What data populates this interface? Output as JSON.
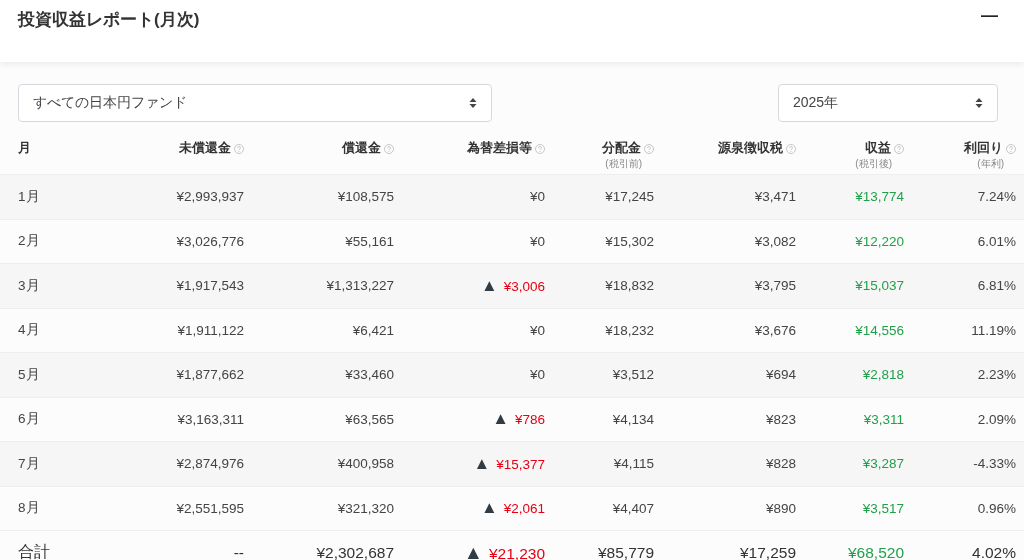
{
  "panel": {
    "title": "投資収益レポート(月次)",
    "collapse_symbol": "—"
  },
  "filters": {
    "fund": {
      "value": "すべての日本円ファンド"
    },
    "year": {
      "value": "2025年"
    }
  },
  "table": {
    "columns": [
      {
        "label": "月"
      },
      {
        "label": "未償還金",
        "help": true
      },
      {
        "label": "償還金",
        "help": true
      },
      {
        "label": "為替差損等",
        "help": true
      },
      {
        "label": "分配金",
        "sub": "(税引前)",
        "help": true
      },
      {
        "label": "源泉徴収税",
        "help": true
      },
      {
        "label": "収益",
        "sub": "(税引後)",
        "help": true
      },
      {
        "label": "利回り",
        "sub": "(年利)",
        "help": true
      }
    ],
    "rows": [
      {
        "month": "1月",
        "outstanding": "¥2,993,937",
        "redemption": "¥108,575",
        "fx": {
          "negative": false,
          "amount": "¥0"
        },
        "distribution": "¥17,245",
        "tax": "¥3,471",
        "profit": "¥13,774",
        "yield": "7.24%"
      },
      {
        "month": "2月",
        "outstanding": "¥3,026,776",
        "redemption": "¥55,161",
        "fx": {
          "negative": false,
          "amount": "¥0"
        },
        "distribution": "¥15,302",
        "tax": "¥3,082",
        "profit": "¥12,220",
        "yield": "6.01%"
      },
      {
        "month": "3月",
        "outstanding": "¥1,917,543",
        "redemption": "¥1,313,227",
        "fx": {
          "negative": true,
          "mark": "▲",
          "amount": "¥3,006"
        },
        "distribution": "¥18,832",
        "tax": "¥3,795",
        "profit": "¥15,037",
        "yield": "6.81%"
      },
      {
        "month": "4月",
        "outstanding": "¥1,911,122",
        "redemption": "¥6,421",
        "fx": {
          "negative": false,
          "amount": "¥0"
        },
        "distribution": "¥18,232",
        "tax": "¥3,676",
        "profit": "¥14,556",
        "yield": "11.19%"
      },
      {
        "month": "5月",
        "outstanding": "¥1,877,662",
        "redemption": "¥33,460",
        "fx": {
          "negative": false,
          "amount": "¥0"
        },
        "distribution": "¥3,512",
        "tax": "¥694",
        "profit": "¥2,818",
        "yield": "2.23%"
      },
      {
        "month": "6月",
        "outstanding": "¥3,163,311",
        "redemption": "¥63,565",
        "fx": {
          "negative": true,
          "mark": "▲",
          "amount": "¥786"
        },
        "distribution": "¥4,134",
        "tax": "¥823",
        "profit": "¥3,311",
        "yield": "2.09%"
      },
      {
        "month": "7月",
        "outstanding": "¥2,874,976",
        "redemption": "¥400,958",
        "fx": {
          "negative": true,
          "mark": "▲",
          "amount": "¥15,377"
        },
        "distribution": "¥4,115",
        "tax": "¥828",
        "profit": "¥3,287",
        "yield": "-4.33%"
      },
      {
        "month": "8月",
        "outstanding": "¥2,551,595",
        "redemption": "¥321,320",
        "fx": {
          "negative": true,
          "mark": "▲",
          "amount": "¥2,061"
        },
        "distribution": "¥4,407",
        "tax": "¥890",
        "profit": "¥3,517",
        "yield": "0.96%"
      }
    ],
    "total": {
      "month": "合計",
      "outstanding": "--",
      "redemption": "¥2,302,687",
      "fx": {
        "negative": true,
        "mark": "▲",
        "amount": "¥21,230"
      },
      "distribution": "¥85,779",
      "tax": "¥17,259",
      "profit": "¥68,520",
      "yield": "4.02%"
    }
  }
}
